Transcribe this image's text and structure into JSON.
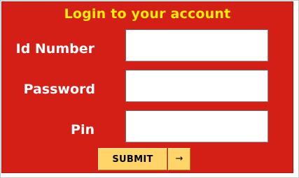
{
  "form": {
    "title": "Login to your account",
    "fields": [
      {
        "label": "Id Number",
        "value": "",
        "placeholder": ""
      },
      {
        "label": "Password",
        "value": "",
        "placeholder": ""
      },
      {
        "label": "Pin",
        "value": "",
        "placeholder": ""
      }
    ],
    "submit_label": "SUBMIT",
    "arrow_glyph": "→"
  },
  "colors": {
    "panel_background": "#d41f17",
    "title_text": "#ffee00",
    "label_text": "#ffffff",
    "button_background": "#ffd56a"
  }
}
